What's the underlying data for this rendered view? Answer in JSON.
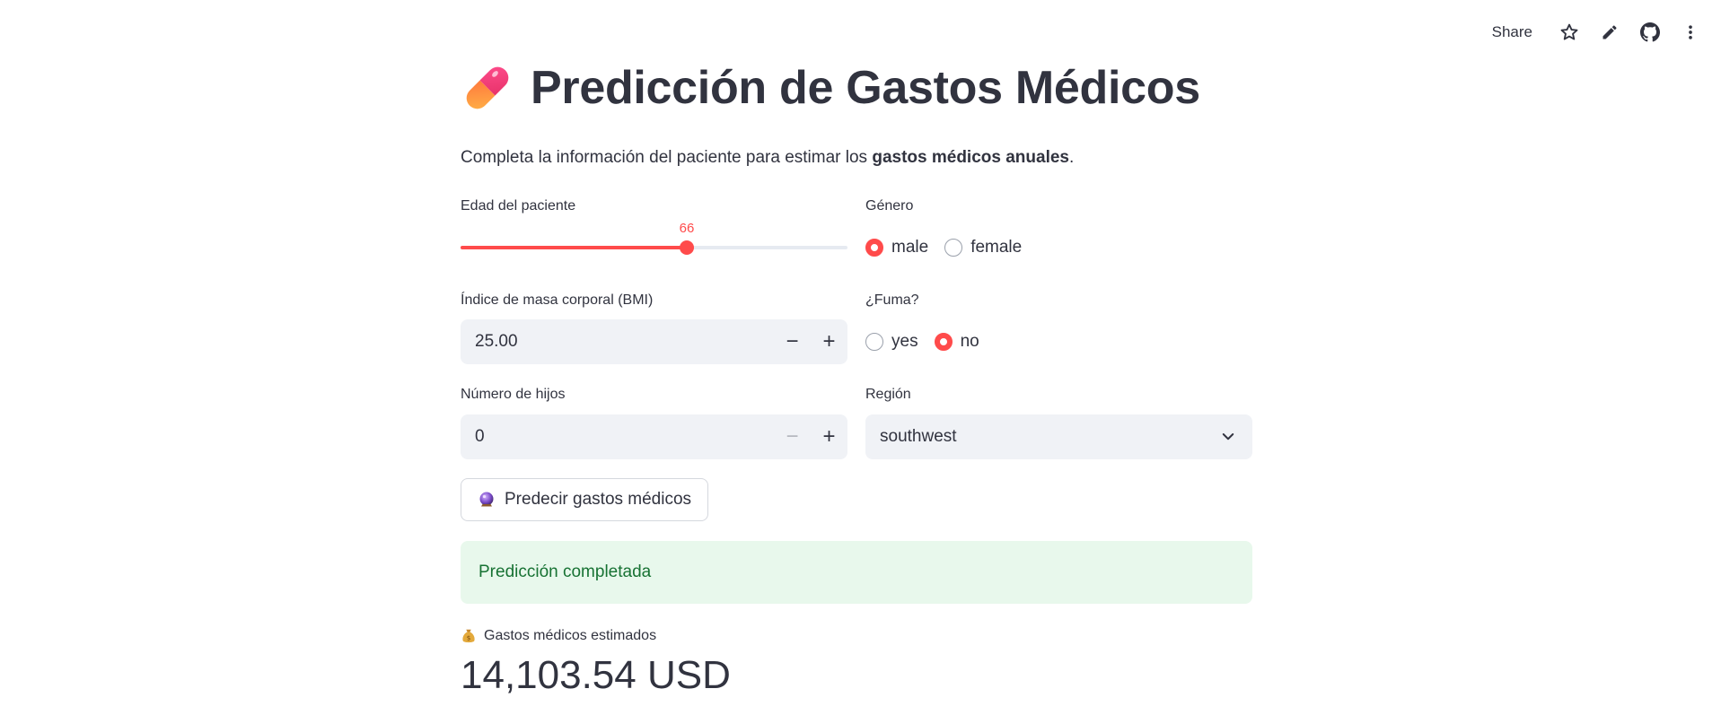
{
  "toolbar": {
    "share_label": "Share",
    "icons": [
      "star-icon",
      "edit-icon",
      "github-icon",
      "more-vert-icon"
    ]
  },
  "header": {
    "title_icon": "pill-icon",
    "title": "Predicción de Gastos Médicos"
  },
  "intro": {
    "text_before": "Completa la información del paciente para estimar los ",
    "text_bold": "gastos médicos anuales",
    "text_after": "."
  },
  "form": {
    "age": {
      "label": "Edad del paciente",
      "value": "66",
      "min": 18,
      "max": 100,
      "value_num": 66
    },
    "gender": {
      "label": "Género",
      "options": [
        "male",
        "female"
      ],
      "selected": "male"
    },
    "bmi": {
      "label": "Índice de masa corporal (BMI)",
      "value": "25.00"
    },
    "smoker": {
      "label": "¿Fuma?",
      "options": [
        "yes",
        "no"
      ],
      "selected": "no"
    },
    "children": {
      "label": "Número de hijos",
      "value": "0"
    },
    "region": {
      "label": "Región",
      "value": "southwest"
    },
    "predict_button": {
      "icon": "crystal-ball-icon",
      "label": "Predecir gastos médicos"
    }
  },
  "result": {
    "alert": "Predicción completada",
    "metric_icon": "money-bag-icon",
    "metric_label": "Gastos médicos estimados",
    "metric_value": "14,103.54 USD"
  },
  "colors": {
    "accent": "#ff4b4b",
    "text": "#31333f",
    "input_bg": "#f0f2f6",
    "success_bg": "#e8f8ec",
    "success_text": "#177233"
  }
}
